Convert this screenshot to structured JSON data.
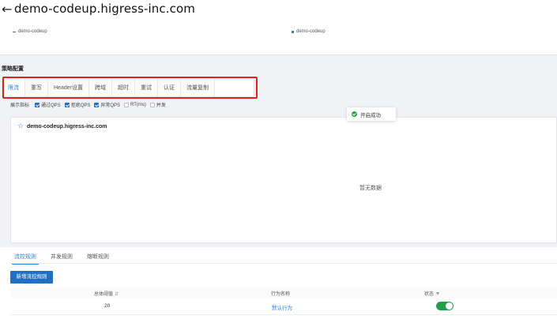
{
  "header": {
    "back_icon": "arrow-left-icon",
    "title": "demo-codeup.higress-inc.com"
  },
  "top_chart": {
    "legend": [
      {
        "label": "demo-codeup",
        "marker": "dash",
        "color": "#666666"
      },
      {
        "label": "demo-codeup",
        "marker": "square",
        "color": "#2f7fd0"
      }
    ]
  },
  "strategy": {
    "title": "策略配置",
    "tabs": [
      "限流",
      "重写",
      "Header设置",
      "跨域",
      "超时",
      "重试",
      "认证",
      "流量复制"
    ],
    "active_tab": "限流"
  },
  "metrics": {
    "label": "展示指标",
    "options": [
      {
        "label": "通过QPS",
        "checked": true
      },
      {
        "label": "拒绝QPS",
        "checked": true
      },
      {
        "label": "异常QPS",
        "checked": true
      },
      {
        "label": "RT(ms)",
        "checked": false
      },
      {
        "label": "并发",
        "checked": false
      }
    ]
  },
  "toast": {
    "icon": "check-circle-icon",
    "text": "开启成功",
    "color": "#23a04b"
  },
  "chart_panel": {
    "star_icon": "star-icon",
    "domain": "demo-codeup.higress-inc.com",
    "empty_text": "暂无数据"
  },
  "rules": {
    "tabs": [
      "流控规则",
      "并发规则",
      "熔断规则"
    ],
    "active_tab": "流控规则",
    "add_button": "新增流控规则",
    "columns": {
      "threshold": "总体阈值",
      "behavior": "行为名称",
      "status": "状态"
    },
    "rows": [
      {
        "threshold": "20",
        "behavior": "默认行为",
        "enabled": true
      }
    ]
  },
  "colors": {
    "accent": "#1f6fc4",
    "link": "#2f7fd0",
    "success": "#23a04b",
    "highlight": "#d9261c"
  }
}
